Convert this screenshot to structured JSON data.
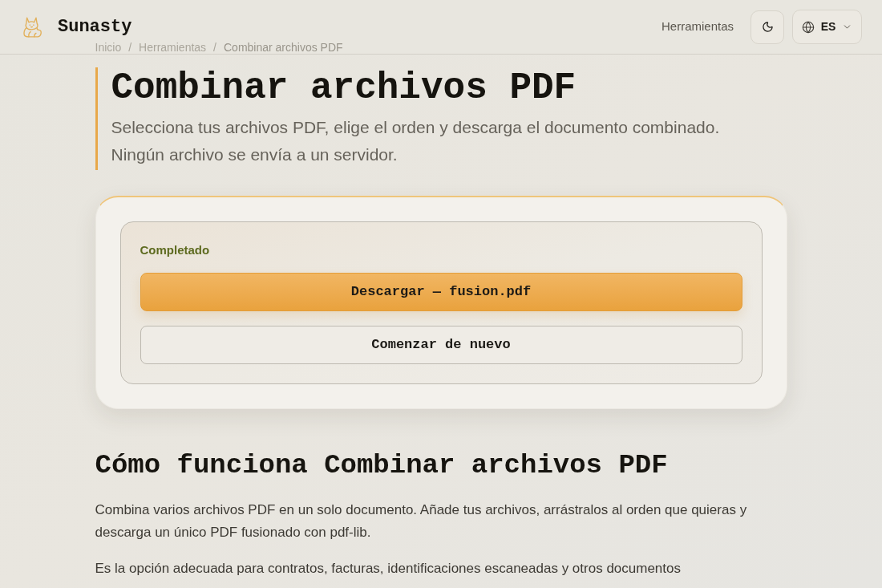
{
  "header": {
    "brand": "Sunasty",
    "nav_link": "Herramientas",
    "language": "ES"
  },
  "breadcrumb": {
    "separator": "/",
    "items": [
      "Inicio",
      "Herramientas",
      "Combinar archivos PDF"
    ]
  },
  "hero": {
    "title": "Combinar archivos PDF",
    "subtitle": "Selecciona tus archivos PDF, elige el orden y descarga el documento combinado. Ningún archivo se envía a un servidor."
  },
  "result_card": {
    "status": "Completado",
    "buttons": [
      {
        "kind": "primary",
        "label": "Descargar — fusion.pdf"
      },
      {
        "kind": "secondary",
        "label": "Comenzar de nuevo"
      }
    ]
  },
  "how_it_works": {
    "heading": "Cómo funciona Combinar archivos PDF",
    "paragraphs": [
      "Combina varios archivos PDF en un solo documento. Añade tus archivos, arrástralos al orden que quieras y descarga un único PDF fusionado con pdf-lib.",
      "Es la opción adecuada para contratos, facturas, identificaciones escaneadas y otros documentos"
    ]
  }
}
